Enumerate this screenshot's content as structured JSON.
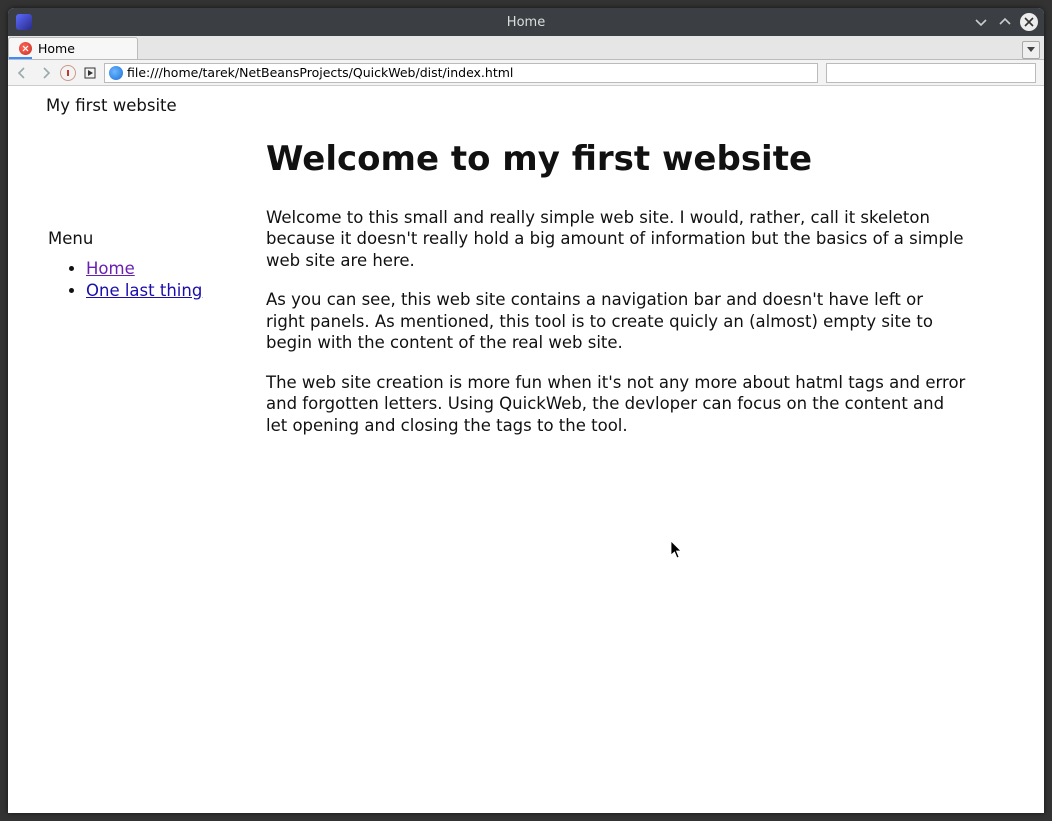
{
  "window": {
    "title": "Home"
  },
  "tab": {
    "label": "Home"
  },
  "navbar": {
    "url": "file:///home/tarek/NetBeansProjects/QuickWeb/dist/index.html"
  },
  "site": {
    "header_title": "My first website"
  },
  "sidebar": {
    "title": "Menu",
    "items": [
      {
        "label": "Home"
      },
      {
        "label": "One last thing"
      }
    ]
  },
  "main": {
    "heading": "Welcome to my first website",
    "paragraphs": [
      "Welcome to this small and really simple web site. I would, rather, call it skeleton because it doesn't really hold a big amount of information but the basics of a simple web site are here.",
      "As you can see, this web site contains a navigation bar and doesn't have left or right panels. As mentioned, this tool is to create quicly an (almost) empty site to begin with the content of the real web site.",
      "The web site creation is more fun when it's not any more about hatml tags and error and forgotten letters. Using QuickWeb, the devloper can focus on the content and let opening and closing the tags to the tool."
    ]
  }
}
